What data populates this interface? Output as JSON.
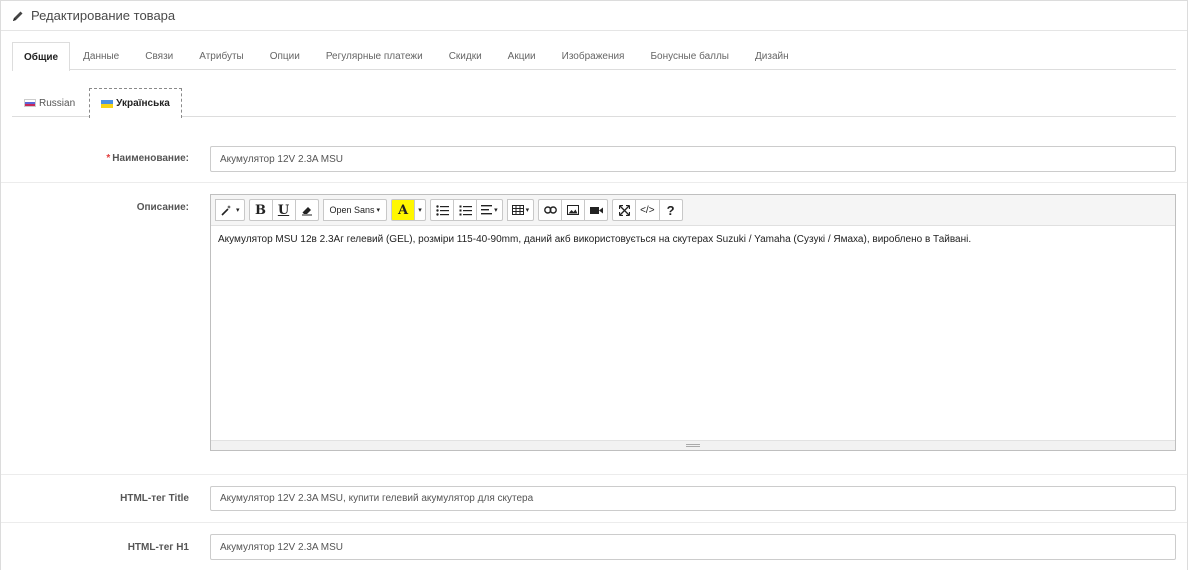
{
  "header": {
    "title": "Редактирование товара",
    "icon": "pencil-icon"
  },
  "tabs": [
    {
      "label": "Общие",
      "active": true
    },
    {
      "label": "Данные"
    },
    {
      "label": "Связи"
    },
    {
      "label": "Атрибуты"
    },
    {
      "label": "Опции"
    },
    {
      "label": "Регулярные платежи"
    },
    {
      "label": "Скидки"
    },
    {
      "label": "Акции"
    },
    {
      "label": "Изображения"
    },
    {
      "label": "Бонусные баллы"
    },
    {
      "label": "Дизайн"
    }
  ],
  "languages": [
    {
      "label": "Russian",
      "active": false
    },
    {
      "label": "Українська",
      "active": true
    }
  ],
  "form": {
    "name": {
      "required_mark": "*",
      "label": "Наименование:",
      "value": "Акумулятор 12V 2.3A MSU"
    },
    "description": {
      "label": "Описание:",
      "content": "Акумулятор MSU 12в 2.3Аг гелевий (GEL), розміри 115-40-90mm, даний акб використовується на скутерах Suzuki / Yamaha (Сузукі / Ямаха), вироблено в Тайвані."
    },
    "meta_title": {
      "label": "HTML-тег Title",
      "value": "Акумулятор 12V 2.3A MSU, купити гелевий акумулятор для скутера"
    },
    "h1": {
      "label": "HTML-тег H1",
      "value": "Акумулятор 12V 2.3A MSU"
    }
  },
  "toolbar": {
    "bold": "B",
    "underline": "U",
    "font_name": "Open Sans",
    "color_letter": "A",
    "help": "?",
    "code": "</>",
    "highlight_color": "#fff700"
  }
}
